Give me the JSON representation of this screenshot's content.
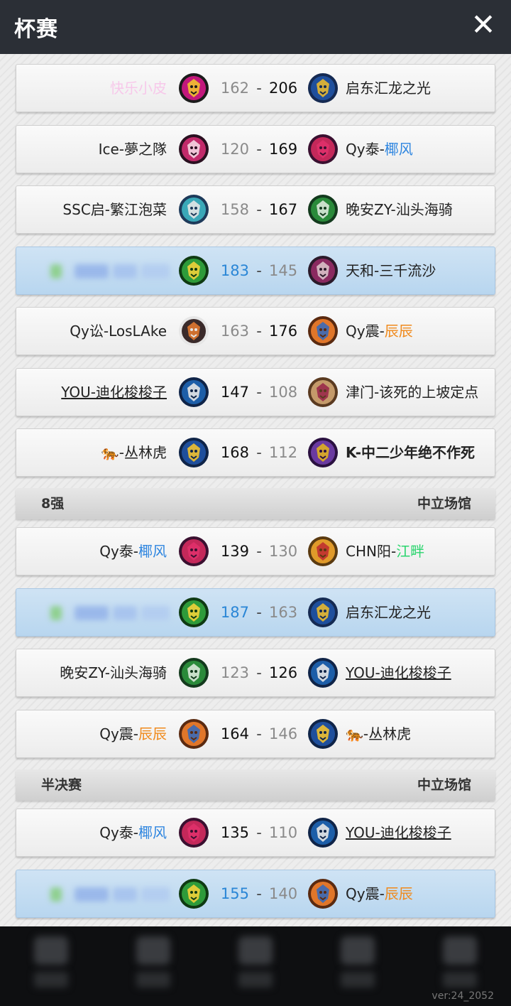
{
  "header": {
    "title": "杯赛",
    "close_label": "✕"
  },
  "matches_a": [
    {
      "home": {
        "text": "快乐小皮",
        "color": "#f7c8ea"
      },
      "home_badge": "pink-lion-badge",
      "home_score": "162",
      "away_score": "206",
      "away": {
        "text": "启东汇龙之光"
      },
      "away_badge": "blue-lion-badge",
      "winner": "away"
    },
    {
      "home": {
        "text": "Ice-夢之隊"
      },
      "home_badge": "pink-dragon-badge",
      "home_score": "120",
      "away_score": "169",
      "away": {
        "prefix": "Qy泰-",
        "suffix": "椰风",
        "suffix_color": "#2f86e0"
      },
      "away_badge": "red-eagle-badge",
      "winner": "away"
    },
    {
      "home": {
        "text": "SSC启-繁江泡菜"
      },
      "home_badge": "knight-shield-badge",
      "home_score": "158",
      "away_score": "167",
      "away": {
        "text": "晚安ZY-汕头海骑"
      },
      "away_badge": "green-wolf-badge",
      "winner": "away"
    },
    {
      "home": {
        "text": ""
      },
      "home_badge": "green-croc-badge",
      "home_score": "183",
      "away_score": "145",
      "away": {
        "text": "天和-三千流沙"
      },
      "away_badge": "purple-owl-badge",
      "winner": "home",
      "highlight": true
    },
    {
      "home": {
        "text": "Qy讼-LosLAke"
      },
      "home_badge": "fox-shield-badge",
      "home_score": "163",
      "away_score": "176",
      "away": {
        "prefix": "Qy震-",
        "suffix": "辰辰",
        "suffix_color": "#f08a1c"
      },
      "away_badge": "orange-tiger-badge",
      "winner": "away"
    },
    {
      "home": {
        "text": "YOU-迪化梭梭子",
        "underline": true
      },
      "home_badge": "blue-wolf-badge",
      "home_score": "147",
      "away_score": "108",
      "away": {
        "text": "津门-该死的上坡定点"
      },
      "away_badge": "tan-lion-badge",
      "winner": "home"
    },
    {
      "home": {
        "text": "🐅-丛林虎"
      },
      "home_badge": "blue-lynx-badge",
      "home_score": "168",
      "away_score": "112",
      "away": {
        "text": "K-中二少年绝不作死",
        "bold": true
      },
      "away_badge": "purple-bear-badge",
      "winner": "home"
    }
  ],
  "section_8": {
    "left": "8强",
    "right": "中立场馆"
  },
  "matches_b": [
    {
      "home": {
        "prefix": "Qy泰-",
        "suffix": "椰风",
        "suffix_color": "#2f86e0"
      },
      "home_badge": "red-eagle-badge",
      "home_score": "139",
      "away_score": "130",
      "away": {
        "prefix": "CHN阳-",
        "suffix": "江畔",
        "suffix_color": "#2bd56e"
      },
      "away_badge": "orange-bull-badge",
      "winner": "home"
    },
    {
      "home": {
        "text": ""
      },
      "home_badge": "green-croc-badge",
      "home_score": "187",
      "away_score": "163",
      "away": {
        "text": "启东汇龙之光"
      },
      "away_badge": "blue-lion-badge",
      "winner": "home",
      "highlight": true
    },
    {
      "home": {
        "text": "晚安ZY-汕头海骑"
      },
      "home_badge": "green-wolf-badge",
      "home_score": "123",
      "away_score": "126",
      "away": {
        "text": "YOU-迪化梭梭子",
        "underline": true
      },
      "away_badge": "blue-wolf-badge",
      "winner": "away"
    },
    {
      "home": {
        "prefix": "Qy震-",
        "suffix": "辰辰",
        "suffix_color": "#f08a1c"
      },
      "home_badge": "orange-tiger-badge",
      "home_score": "164",
      "away_score": "146",
      "away": {
        "text": "🐅-丛林虎"
      },
      "away_badge": "blue-lynx-badge",
      "winner": "home"
    }
  ],
  "section_semi": {
    "left": "半决赛",
    "right": "中立场馆"
  },
  "matches_c": [
    {
      "home": {
        "prefix": "Qy泰-",
        "suffix": "椰风",
        "suffix_color": "#2f86e0"
      },
      "home_badge": "red-eagle-badge",
      "home_score": "135",
      "away_score": "110",
      "away": {
        "text": "YOU-迪化梭梭子",
        "underline": true
      },
      "away_badge": "blue-wolf-badge",
      "winner": "home"
    },
    {
      "home": {
        "text": ""
      },
      "home_badge": "green-croc-badge",
      "home_score": "155",
      "away_score": "140",
      "away": {
        "prefix": "Qy震-",
        "suffix": "辰辰",
        "suffix_color": "#f08a1c"
      },
      "away_badge": "orange-tiger-badge",
      "winner": "home",
      "highlight": true
    }
  ],
  "score_separator": "-",
  "version": "ver:24_2052",
  "badge_colors": {
    "pink-lion-badge": [
      "#c2187c",
      "#1b1b1b",
      "#f2c230"
    ],
    "blue-lion-badge": [
      "#1f4f9c",
      "#152a52",
      "#e8b830"
    ],
    "pink-dragon-badge": [
      "#c22a6a",
      "#2a1020",
      "#f4d6e2"
    ],
    "red-eagle-badge": [
      "#c4285a",
      "#3a1030",
      "#e0306a"
    ],
    "knight-shield-badge": [
      "#3aa8b8",
      "#1d3a5a",
      "#e6e6e6"
    ],
    "green-wolf-badge": [
      "#2a8a3a",
      "#133a1d",
      "#d9e8d9"
    ],
    "green-croc-badge": [
      "#2e9b3a",
      "#0f3a12",
      "#f1d23a"
    ],
    "purple-owl-badge": [
      "#8a2a60",
      "#2a1a2a",
      "#d8c0c8"
    ],
    "fox-shield-badge": [
      "#3a2a2a",
      "#e6e6e6",
      "#e07830"
    ],
    "orange-tiger-badge": [
      "#e0762a",
      "#5a2a10",
      "#3a6ab8"
    ],
    "blue-wolf-badge": [
      "#1d5ea8",
      "#0f2448",
      "#e6e6e6"
    ],
    "tan-lion-badge": [
      "#c49a6a",
      "#5a3a20",
      "#9a2a4a"
    ],
    "blue-lynx-badge": [
      "#1f4f9c",
      "#0f2448",
      "#f0c030"
    ],
    "purple-bear-badge": [
      "#6a3aa0",
      "#2a1040",
      "#e0b020"
    ],
    "orange-bull-badge": [
      "#e09a2a",
      "#5a3a10",
      "#c03030"
    ]
  }
}
